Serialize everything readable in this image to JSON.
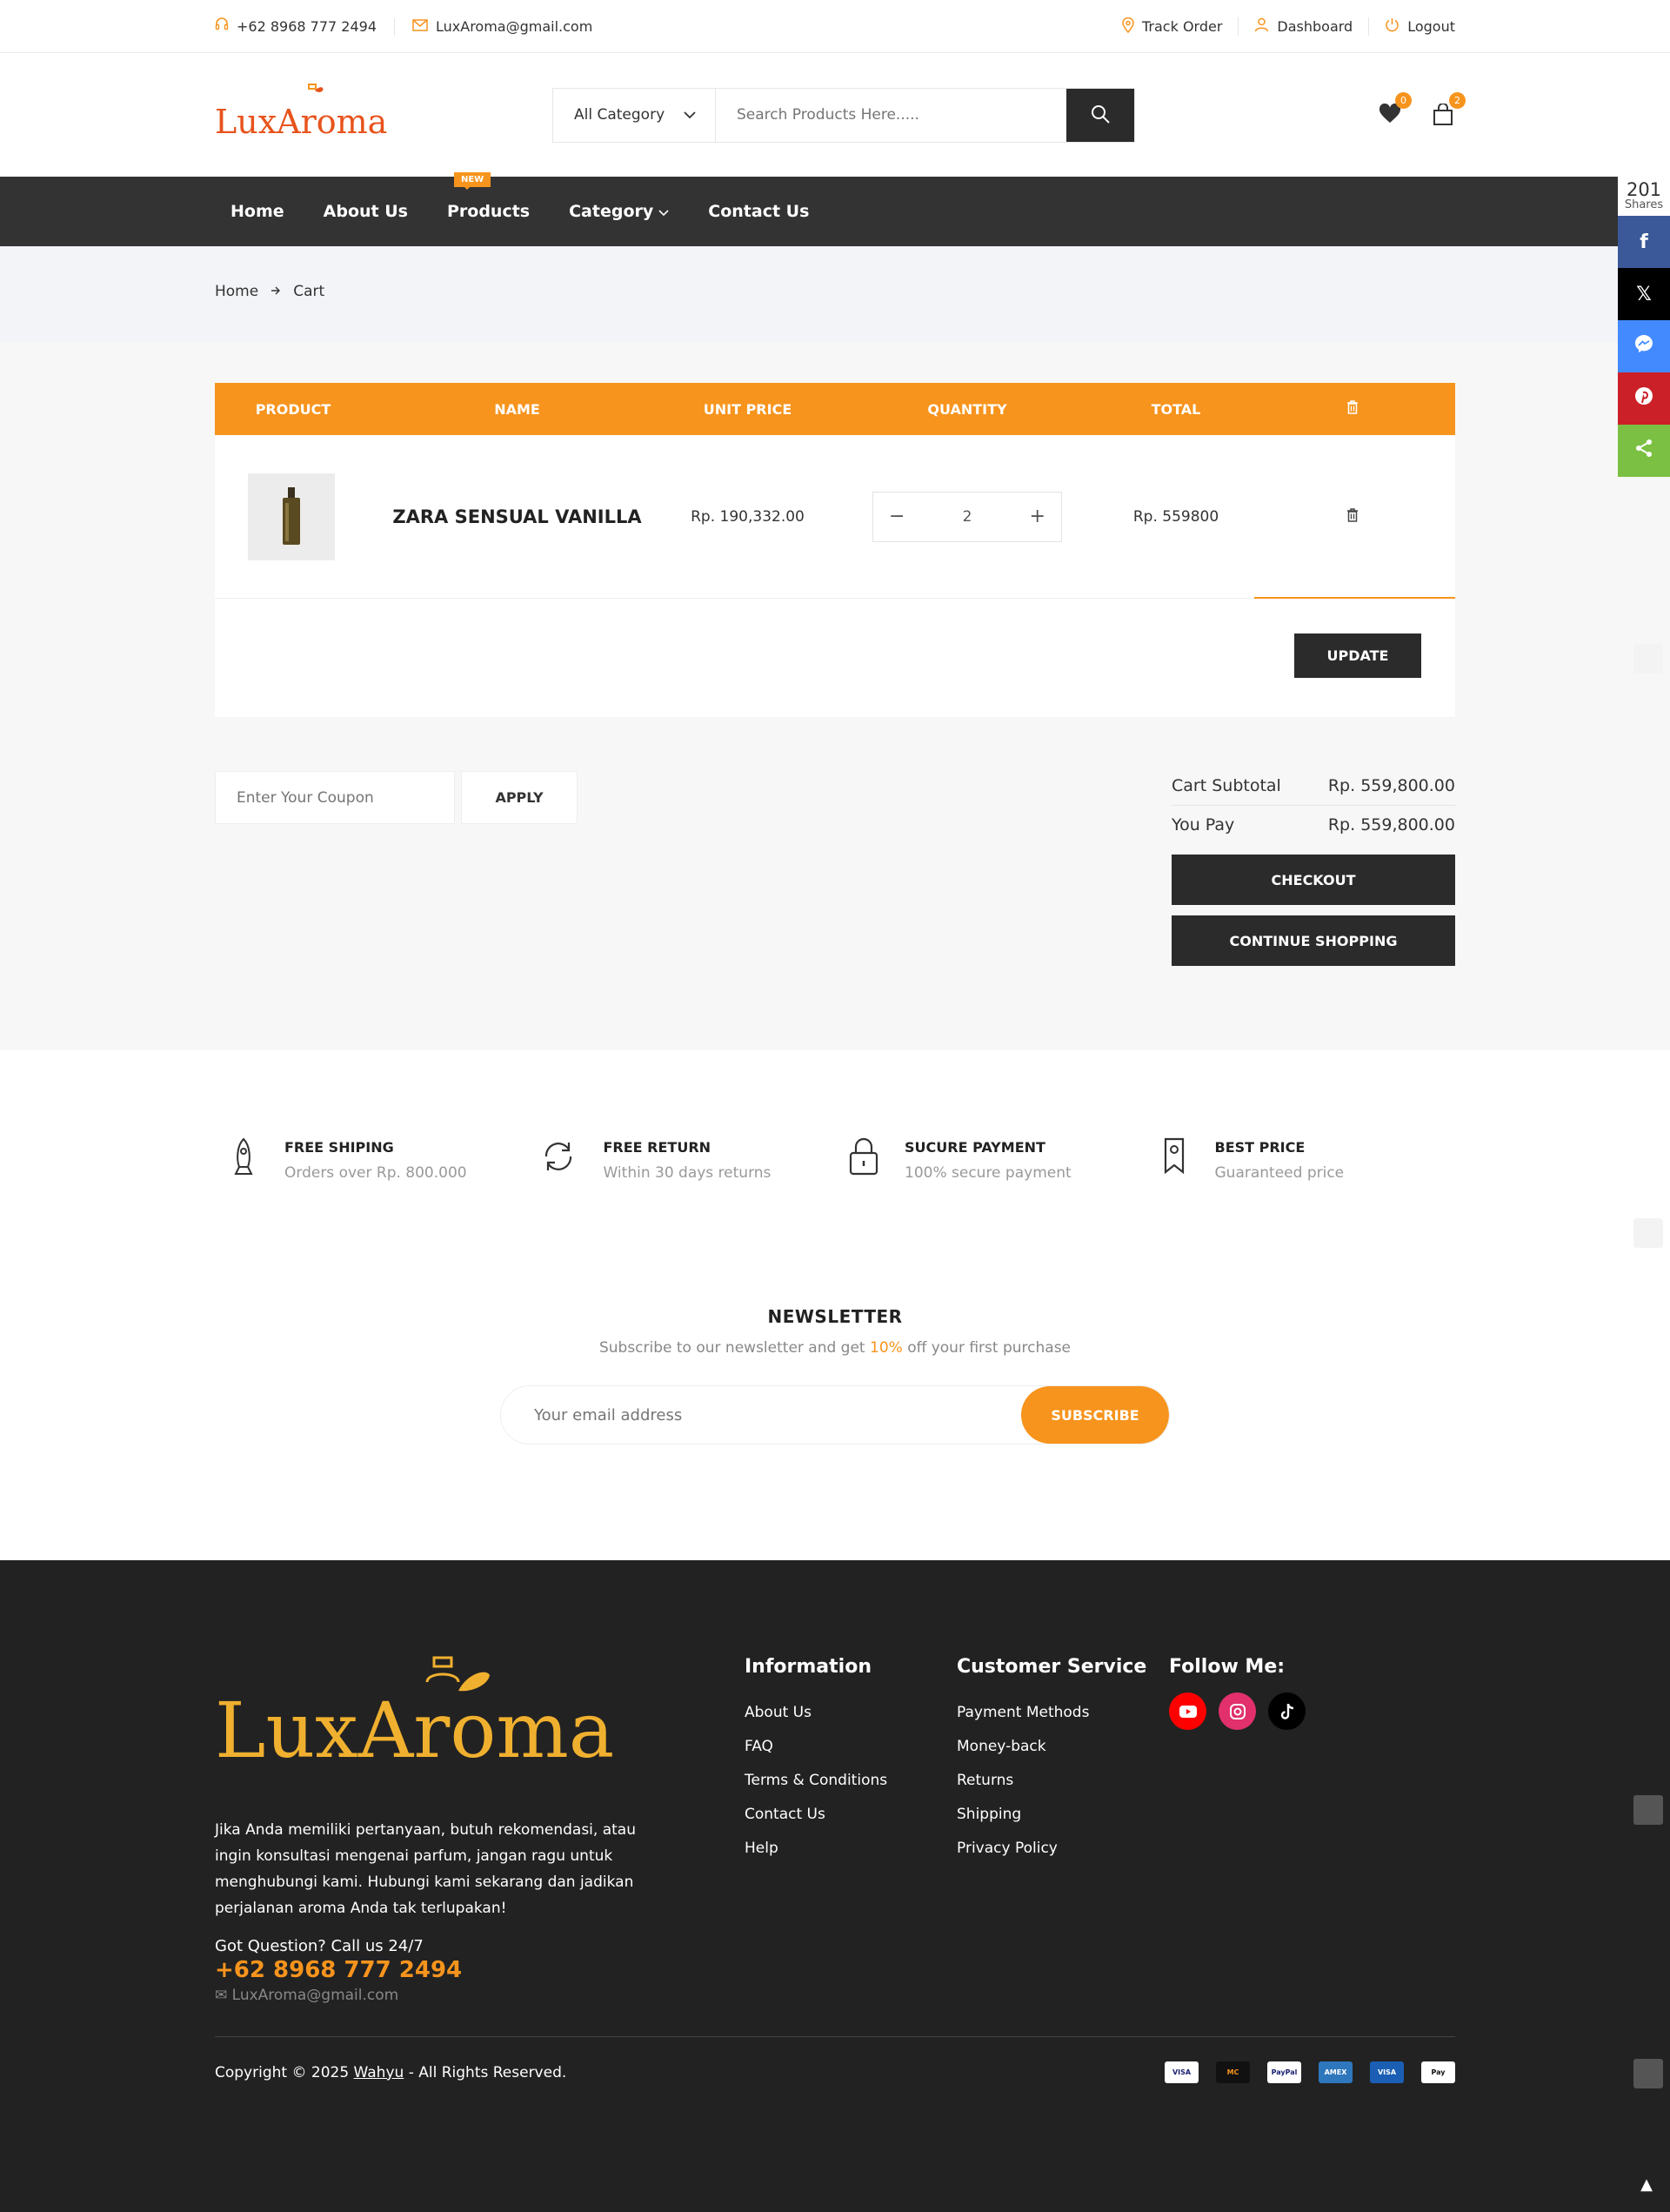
{
  "topbar": {
    "phone": "+62 8968 777 2494",
    "email": "LuxAroma@gmail.com",
    "track_order": "Track Order",
    "dashboard": "Dashboard",
    "logout": "Logout"
  },
  "header": {
    "logo_text": "LuxAroma",
    "category_label": "All Category",
    "search_placeholder": "Search Products Here.....",
    "wishlist_count": "0",
    "cart_count": "2"
  },
  "nav": {
    "items": [
      "Home",
      "About Us",
      "Products",
      "Category",
      "Contact Us"
    ],
    "new_tag": "NEW"
  },
  "breadcrumb": {
    "home": "Home",
    "current": "Cart"
  },
  "cart": {
    "headers": [
      "PRODUCT",
      "NAME",
      "UNIT PRICE",
      "QUANTITY",
      "TOTAL"
    ],
    "rows": [
      {
        "name": "ZARA SENSUAL VANILLA",
        "unit_price": "Rp. 190,332.00",
        "quantity": "2",
        "total": "Rp. 559800"
      }
    ],
    "update_label": "UPDATE",
    "coupon_placeholder": "Enter Your Coupon",
    "apply_label": "APPLY",
    "subtotal_label": "Cart Subtotal",
    "subtotal_value": "Rp. 559,800.00",
    "you_pay_label": "You Pay",
    "you_pay_value": "Rp. 559,800.00",
    "checkout_label": "CHECKOUT",
    "continue_label": "CONTINUE SHOPPING"
  },
  "features": [
    {
      "icon": "rocket-icon",
      "title": "FREE SHIPING",
      "sub": "Orders over Rp. 800.000"
    },
    {
      "icon": "refresh-icon",
      "title": "FREE RETURN",
      "sub": "Within 30 days returns"
    },
    {
      "icon": "lock-icon",
      "title": "SUCURE PAYMENT",
      "sub": "100% secure payment"
    },
    {
      "icon": "tag-icon",
      "title": "BEST PRICE",
      "sub": "Guaranteed price"
    }
  ],
  "newsletter": {
    "title": "NEWSLETTER",
    "text_before": "Subscribe to our newsletter and get ",
    "highlight": "10%",
    "text_after": " off your first purchase",
    "placeholder": "Your email address",
    "button": "SUBSCRIBE"
  },
  "footer": {
    "logo_text": "LuxAroma",
    "about": "Jika Anda memiliki pertanyaan, butuh rekomendasi, atau ingin konsultasi mengenai parfum, jangan ragu untuk menghubungi kami. Hubungi kami sekarang dan jadikan perjalanan aroma Anda tak terlupakan!",
    "question": "Got Question? Call us 24/7",
    "phone": "+62 8968 777 2494",
    "email": "LuxAroma@gmail.com",
    "info_title": "Information",
    "info_links": [
      "About Us",
      "FAQ",
      "Terms & Conditions",
      "Contact Us",
      "Help"
    ],
    "cs_title": "Customer Service",
    "cs_links": [
      "Payment Methods",
      "Money-back",
      "Returns",
      "Shipping",
      "Privacy Policy"
    ],
    "follow_title": "Follow Me:",
    "copyright_before": "Copyright © 2025 ",
    "copyright_link": "Wahyu",
    "copyright_after": " - All Rights Reserved.",
    "payments": [
      "VISA",
      "MC",
      "PayPal",
      "AMEX",
      "VISA",
      "Pay"
    ]
  },
  "share": {
    "count": "201",
    "label": "Shares"
  },
  "colors": {
    "accent": "#f7941d",
    "dark": "#333333",
    "footer": "#222222"
  }
}
